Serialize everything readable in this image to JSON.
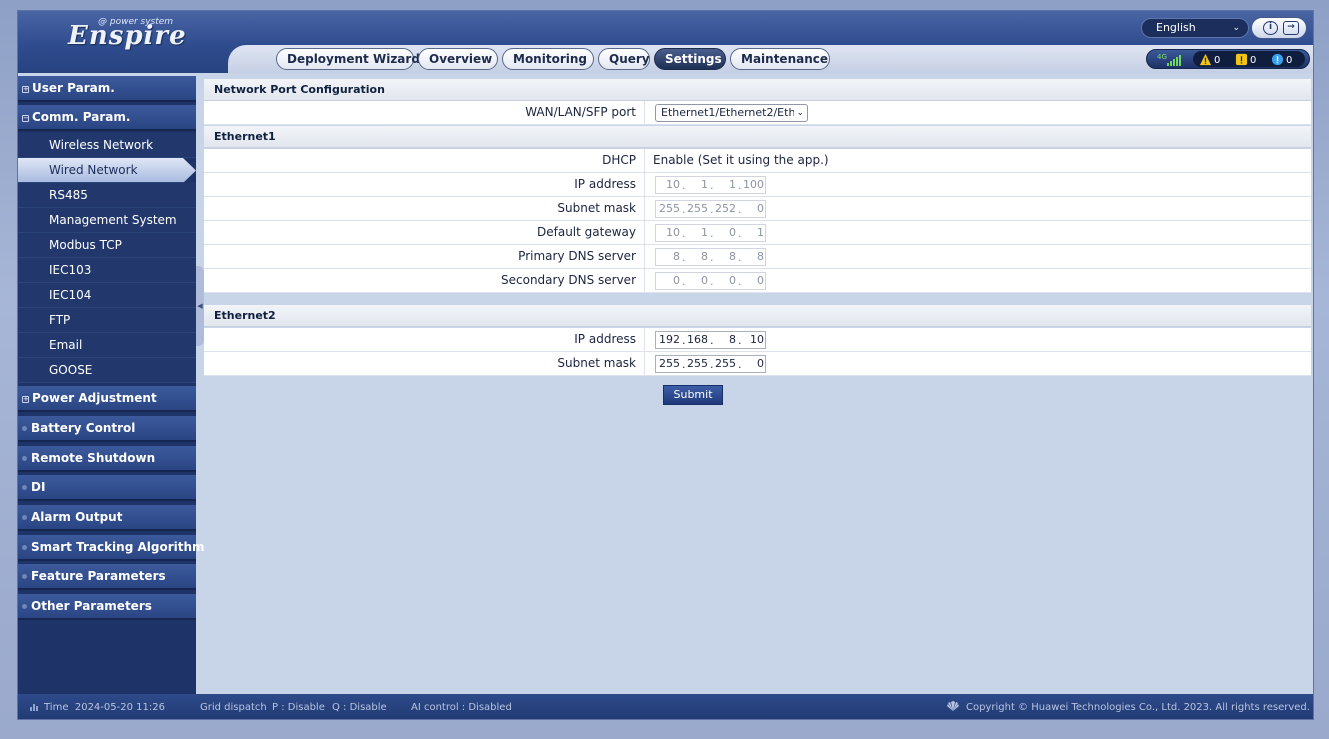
{
  "header": {
    "logo_text": "Enspire",
    "logo_sub": "@ power system",
    "language": "English",
    "tabs": [
      "Deployment Wizard",
      "Overview",
      "Monitoring",
      "Query",
      "Settings",
      "Maintenance"
    ],
    "active_tab": "Settings",
    "network": "4G",
    "alarms": {
      "major": "0",
      "minor": "0",
      "warning": "0"
    }
  },
  "sidebar": {
    "groups": [
      {
        "label": "User Param.",
        "marker": "+"
      },
      {
        "label": "Comm. Param.",
        "marker": "−",
        "items": [
          "Wireless Network",
          "Wired Network",
          "RS485",
          "Management System",
          "Modbus TCP",
          "IEC103",
          "IEC104",
          "FTP",
          "Email",
          "GOOSE"
        ]
      },
      {
        "label": "Power Adjustment",
        "marker": "+"
      },
      {
        "label": "Battery Control"
      },
      {
        "label": "Remote Shutdown"
      },
      {
        "label": "DI"
      },
      {
        "label": "Alarm Output"
      },
      {
        "label": "Smart Tracking Algorithm"
      },
      {
        "label": "Feature Parameters"
      },
      {
        "label": "Other Parameters"
      }
    ],
    "active_item": "Wired Network"
  },
  "content": {
    "section_title": "Network Port Configuration",
    "port_label": "WAN/LAN/SFP port",
    "port_value": "Ethernet1/Ethernet2/Eth",
    "ethernet1": {
      "title": "Ethernet1",
      "dhcp_label": "DHCP",
      "dhcp_value": "Enable (Set it using the app.)",
      "ip_label": "IP address",
      "ip": [
        "10",
        "1",
        "1",
        "100"
      ],
      "mask_label": "Subnet mask",
      "mask": [
        "255",
        "255",
        "252",
        "0"
      ],
      "gw_label": "Default gateway",
      "gw": [
        "10",
        "1",
        "0",
        "1"
      ],
      "dns1_label": "Primary DNS server",
      "dns1": [
        "8",
        "8",
        "8",
        "8"
      ],
      "dns2_label": "Secondary DNS server",
      "dns2": [
        "0",
        "0",
        "0",
        "0"
      ]
    },
    "ethernet2": {
      "title": "Ethernet2",
      "ip_label": "IP address",
      "ip": [
        "192",
        "168",
        "8",
        "10"
      ],
      "mask_label": "Subnet mask",
      "mask": [
        "255",
        "255",
        "255",
        "0"
      ]
    },
    "submit_label": "Submit"
  },
  "footer": {
    "time_label": "Time",
    "time_value": "2024-05-20 11:26",
    "grid_dispatch": "Grid dispatch",
    "p_status": "P : Disable",
    "q_status": "Q : Disable",
    "ai_control": "AI control : Disabled",
    "copyright": "Copyright © Huawei Technologies Co., Ltd. 2023. All rights reserved."
  },
  "colors": {
    "header_blue": "#2f4c8e",
    "sidebar_blue": "#1e3468",
    "active_tab": "#1e2f55",
    "submit_blue": "#2a4a92",
    "alarm_major": "#f2c418",
    "alarm_warning": "#3aa0ea"
  }
}
